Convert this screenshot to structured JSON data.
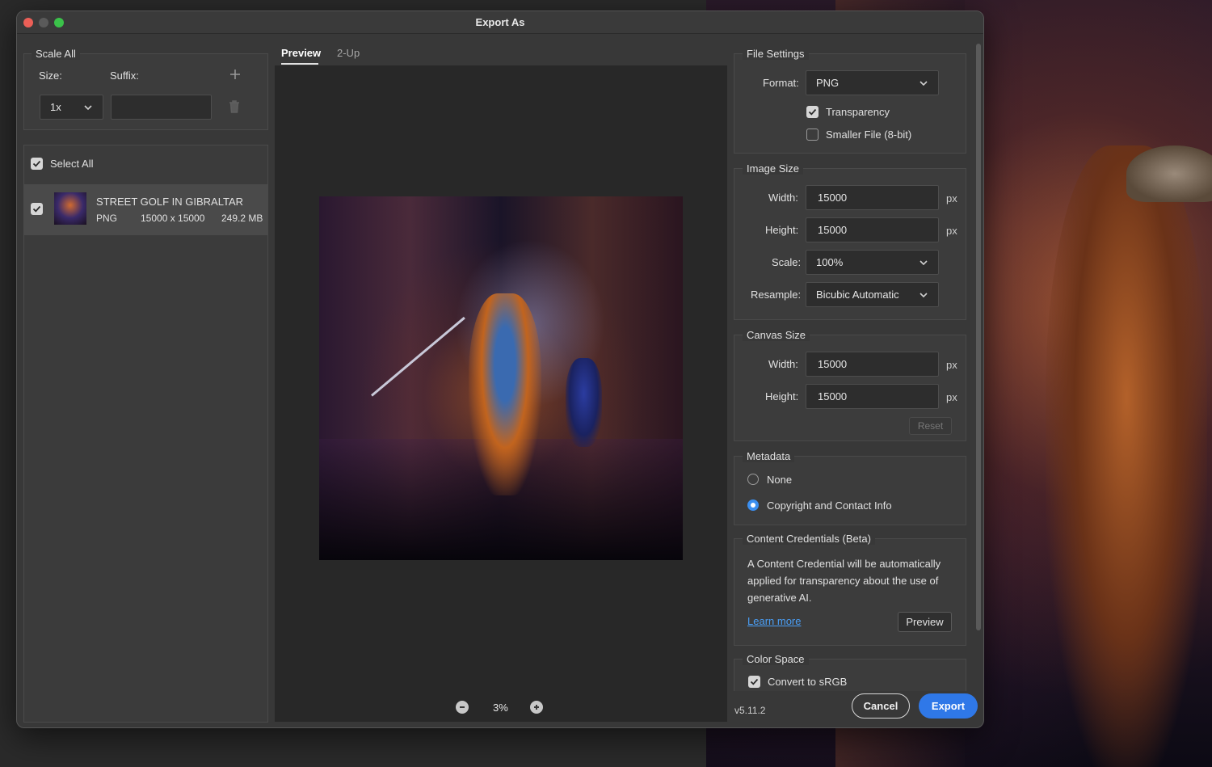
{
  "window": {
    "title": "Export As"
  },
  "scale_all": {
    "heading": "Scale All",
    "size_label": "Size:",
    "suffix_label": "Suffix:",
    "size_value": "1x",
    "suffix_value": ""
  },
  "assets": {
    "select_all_label": "Select All",
    "items": [
      {
        "name": "STREET GOLF IN GIBRALTAR",
        "format": "PNG",
        "dimensions": "15000 x 15000",
        "size": "249.2 MB",
        "checked": true
      }
    ]
  },
  "preview": {
    "tabs": [
      "Preview",
      "2-Up"
    ],
    "active_tab": "Preview",
    "zoom": "3%"
  },
  "file_settings": {
    "heading": "File Settings",
    "format_label": "Format:",
    "format_value": "PNG",
    "transparency_label": "Transparency",
    "transparency_checked": true,
    "smaller_file_label": "Smaller File (8-bit)",
    "smaller_file_checked": false
  },
  "image_size": {
    "heading": "Image Size",
    "width_label": "Width:",
    "width_value": "15000",
    "height_label": "Height:",
    "height_value": "15000",
    "unit": "px",
    "scale_label": "Scale:",
    "scale_value": "100%",
    "resample_label": "Resample:",
    "resample_value": "Bicubic Automatic"
  },
  "canvas_size": {
    "heading": "Canvas Size",
    "width_label": "Width:",
    "width_value": "15000",
    "height_label": "Height:",
    "height_value": "15000",
    "unit": "px",
    "reset_label": "Reset"
  },
  "metadata": {
    "heading": "Metadata",
    "options": [
      "None",
      "Copyright and Contact Info"
    ],
    "selected": "Copyright and Contact Info"
  },
  "content_credentials": {
    "heading": "Content Credentials (Beta)",
    "line1": "A Content Credential will be automatically",
    "line2": "applied for transparency about the use of",
    "line3": "generative AI.",
    "learn_more": "Learn more",
    "preview_button": "Preview"
  },
  "color_space": {
    "heading": "Color Space",
    "convert_label": "Convert to sRGB",
    "convert_checked": true
  },
  "footer": {
    "version": "v5.11.2",
    "cancel_label": "Cancel",
    "export_label": "Export"
  },
  "colors": {
    "accent": "#2f78e8",
    "link": "#4a9ef5",
    "dialog_bg": "#383838"
  }
}
